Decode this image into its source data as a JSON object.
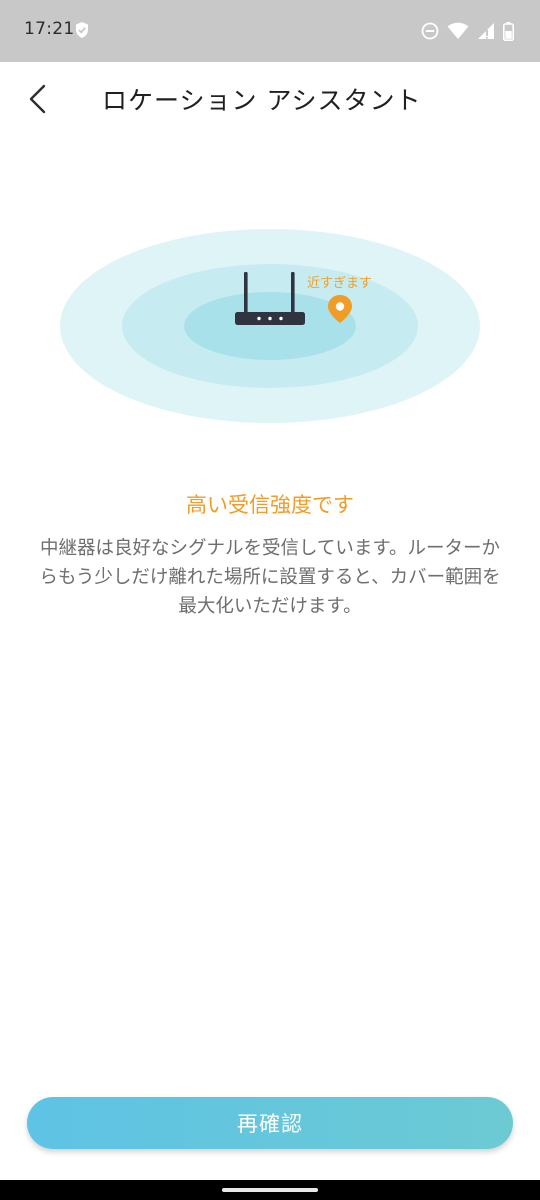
{
  "status_bar": {
    "time": "17:21",
    "left_icon": "shield-check-icon",
    "right_icons": [
      "do-not-disturb-icon",
      "wifi-icon",
      "cell-signal-icon",
      "battery-icon"
    ]
  },
  "header": {
    "back_icon": "chevron-left-icon",
    "title": "ロケーション アシスタント"
  },
  "illustration": {
    "device_icon": "router-icon",
    "marker_icon": "location-pin-icon",
    "marker_label": "近すぎます"
  },
  "result": {
    "title": "高い受信強度です",
    "description": "中継器は良好なシグナルを受信しています。ルーターからもう少しだけ離れた場所に設置すると、カバー範囲を最大化いただけます。"
  },
  "actions": {
    "recheck_label": "再確認"
  },
  "colors": {
    "accent_orange": "#f19c26",
    "button_gradient_start": "#5ec3e5",
    "button_gradient_end": "#6ccad3",
    "ring_outer": "#dff4f7",
    "ring_middle": "#c6ecf1",
    "ring_inner": "#a9e1ea",
    "status_bar": "#c8c8c8"
  }
}
